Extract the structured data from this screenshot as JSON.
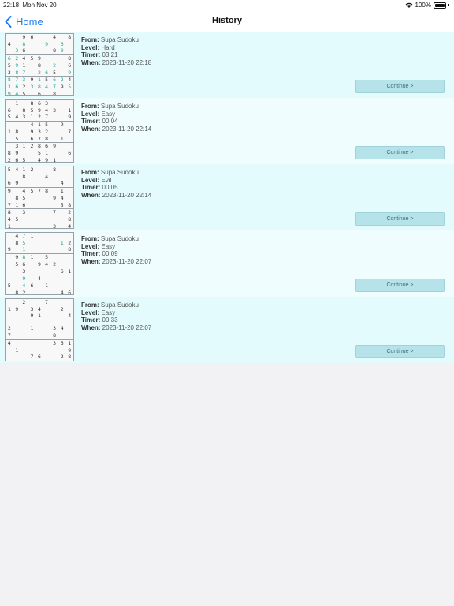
{
  "status_bar": {
    "time": "22:18",
    "date": "Mon Nov 20",
    "battery": "100%"
  },
  "nav": {
    "back_label": "Home",
    "title": "History"
  },
  "labels": {
    "from": "From:",
    "level": "Level:",
    "timer": "Timer:",
    "when": "When:"
  },
  "games": [
    {
      "from": "Supa Sudoku",
      "level": "Hard",
      "timer": "03:21",
      "when": "2023-11-20 22:18",
      "continue_label": "Continue >",
      "grid": [
        "  96  4 8",
        "4 8  9 6 ",
        " 36   89 ",
        "62459   8",
        "591 8 2 6",
        "387 265 9",
        "873915624",
        "162384795",
        "945 6 8  "
      ],
      "user": [
        "       u ",
        "  u  u u ",
        " u     u ",
        "uu       ",
        " u    u  ",
        " uu uu  u",
        "uuu u uu ",
        " u uuuu u",
        "uu     u "
      ]
    },
    {
      "from": "Supa Sudoku",
      "level": "Easy",
      "timer": "00:04",
      "when": "2023-11-20 22:14",
      "continue_label": "Continue >",
      "grid": [
        " 1 863   ",
        "6 85943 1",
        "543127  9",
        "   415 9 ",
        "18 932  7",
        " 5 678 1 ",
        " 312869  ",
        "89  51  6",
        "265 491  "
      ],
      "user": [
        "         ",
        "         ",
        "         ",
        "         ",
        "         ",
        "         ",
        "         ",
        "         ",
        "         "
      ]
    },
    {
      "from": "Supa Sudoku",
      "level": "Evil",
      "timer": "00:05",
      "when": "2023-11-20 22:14",
      "continue_label": "Continue >",
      "grid": [
        "5412  8  ",
        "  8  4   ",
        "69     4 ",
        "9 4578 1 ",
        " 85   94 ",
        "716    58",
        "8 3   7 2",
        "45      8",
        "1     3 4"
      ],
      "user": [
        "         ",
        "         ",
        "         ",
        "         ",
        "         ",
        "         ",
        "         ",
        "         ",
        "         "
      ]
    },
    {
      "from": "Supa Sudoku",
      "level": "Easy",
      "timer": "00:09",
      "when": "2023-11-20 22:07",
      "continue_label": "Continue >",
      "grid": [
        " 471     ",
        " 85    12",
        "9 1     8",
        " 981 5   ",
        " 56 942  ",
        "  3    61",
        "  9 4    ",
        "5 46 1   ",
        " 82    46"
      ],
      "user": [
        "  u      ",
        "  u    u ",
        "  u      ",
        "  u      ",
        "         ",
        "         ",
        "  u      ",
        "  u      ",
        "         "
      ]
    },
    {
      "from": "Supa Sudoku",
      "level": "Easy",
      "timer": "00:33",
      "when": "2023-11-20 22:07",
      "continue_label": "Continue >",
      "grid": [
        "  2  7   ",
        "19 34  2 ",
        "   91   4",
        "         ",
        "2  1  34 ",
        "7     8  ",
        "4     361",
        " 1      9",
        "   76  28"
      ],
      "user": [
        "         ",
        "         ",
        "         ",
        "         ",
        "         ",
        "         ",
        "         ",
        "         ",
        "         "
      ]
    }
  ]
}
